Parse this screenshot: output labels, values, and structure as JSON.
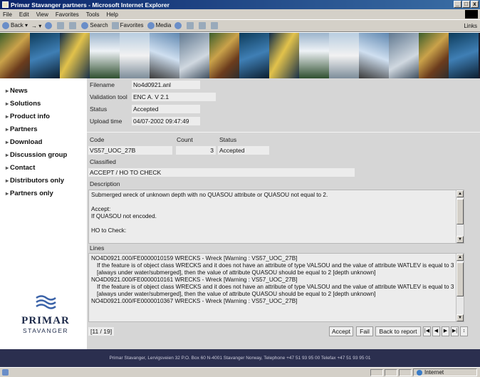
{
  "window": {
    "title": "Primar Stavanger partners - Microsoft Internet Explorer",
    "controls": [
      "_",
      "□",
      "x"
    ]
  },
  "menu": [
    "File",
    "Edit",
    "View",
    "Favorites",
    "Tools",
    "Help"
  ],
  "toolbar": {
    "back": "Back",
    "search": "Search",
    "favorites": "Favorites",
    "media": "Media",
    "links": "Links"
  },
  "nav": [
    "News",
    "Solutions",
    "Product info",
    "Partners",
    "Download",
    "Discussion group",
    "Contact",
    "Distributors only",
    "Partners only"
  ],
  "logo": {
    "name": "PRIMAR",
    "sub": "STAVANGER"
  },
  "file_info": {
    "filename_label": "Filename",
    "filename": "No4d0921.anl",
    "tool_label": "Validation tool",
    "tool": "ENC A. V 2.1",
    "status_label": "Status",
    "status": "Accepted",
    "upload_label": "Upload time",
    "upload": "04/07-2002 09:47:49"
  },
  "result": {
    "code_label": "Code",
    "count_label": "Count",
    "status_label": "Status",
    "code": "VS57_UOC_27B",
    "count": "3",
    "status": "Accepted",
    "classified_label": "Classified",
    "classified": "ACCEPT / HO TO CHECK",
    "description_label": "Description",
    "description_1": "Submerged wreck of unknown depth with no QUASOU attribute or QUASOU not equal to 2.",
    "description_2": "Accept:",
    "description_3": "If QUASOU not encoded.",
    "description_4": "HO to Check:",
    "lines_label": "Lines",
    "line1_head": "NO4D0921.000/FE0000010159  WRECKS - Wreck [Warning : VS57_UOC_27B]",
    "line1_body": "If the feature is of object class WRECKS and it does not have an attribute of type VALSOU and the value of attribute WATLEV is equal to 3 [always under water/submerged], then the value of attribute QUASOU should be equal to 2 [depth unknown]",
    "line2_head": "NO4D0921.000/FE0000010161  WRECKS - Wreck [Warning : VS57_UOC_27B]",
    "line2_body": "If the feature is of object class WRECKS and it does not have an attribute of type VALSOU and the value of attribute WATLEV is equal to 3 [always under water/submerged], then the value of attribute QUASOU should be equal to 2 [depth unknown]",
    "line3_head": "NO4D0921.000/FE0000010367  WRECKS - Wreck [Warning : VS57_UOC_27B]"
  },
  "bottom": {
    "counter": "[11 / 19]",
    "accept": "Accept",
    "fail": "Fail",
    "back_to_report": "Back to report",
    "first": "|◀",
    "prev": "◀",
    "next": "▶",
    "last": "▶|",
    "more": "↕"
  },
  "footer": "Primar Stavanger, Lervigsveien 32 P.O. Box 60 N-4001 Stavanger Norway, Telephone +47 51 93 95 00 Telefax +47 51 93 95 01",
  "statusbar": {
    "zone": "Internet"
  }
}
